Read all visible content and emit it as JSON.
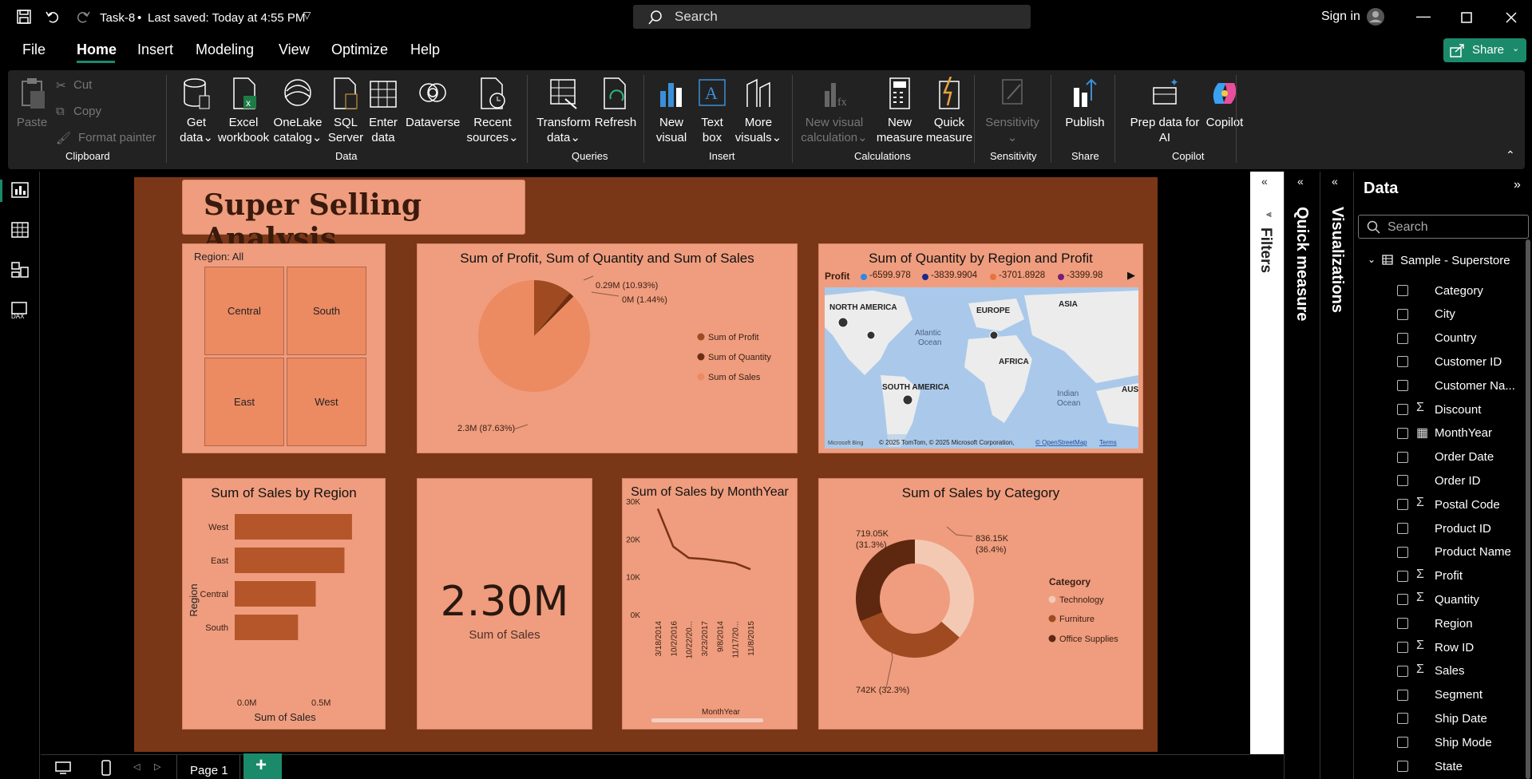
{
  "titlebar": {
    "doc_title": "Task-8",
    "saved": "Last saved: Today at 4:55 PM",
    "search": "Search",
    "signin": "Sign in"
  },
  "menu": {
    "file": "File",
    "home": "Home",
    "insert": "Insert",
    "modeling": "Modeling",
    "view": "View",
    "optimize": "Optimize",
    "help": "Help",
    "share": "Share"
  },
  "ribbon": {
    "paste": "Paste",
    "cut": "Cut",
    "copy": "Copy",
    "format_painter": "Format painter",
    "clipboard": "Clipboard",
    "get_data": "Get",
    "get_data2": "data",
    "excel": "Excel",
    "excel2": "workbook",
    "onelake": "OneLake",
    "onelake2": "catalog",
    "sql": "SQL",
    "sql2": "Server",
    "enter": "Enter",
    "enter2": "data",
    "dataverse": "Dataverse",
    "recent": "Recent",
    "recent2": "sources",
    "data_group": "Data",
    "transform": "Transform",
    "transform2": "data",
    "refresh": "Refresh",
    "queries": "Queries",
    "new_visual": "New",
    "new_visual2": "visual",
    "textbox": "Text",
    "textbox2": "box",
    "more_visuals": "More",
    "more_visuals2": "visuals",
    "insert_group": "Insert",
    "new_visual_calc": "New visual",
    "new_visual_calc2": "calculation",
    "new_measure": "New",
    "new_measure2": "measure",
    "quick_measure": "Quick",
    "quick_measure2": "measure",
    "calc_group": "Calculations",
    "sensitivity": "Sensitivity",
    "sensitivity_group": "Sensitivity",
    "publish": "Publish",
    "share_group": "Share",
    "prep": "Prep data for",
    "prep2": "AI",
    "copilot": "Copilot",
    "copilot_group": "Copilot"
  },
  "report": {
    "title": "Super Selling Analysis",
    "region_label": "Region: All",
    "regions": [
      "Central",
      "South",
      "East",
      "West"
    ],
    "pie_title": "Sum of Profit, Sum of Quantity and Sum of Sales",
    "pie_labels": {
      "profit": "0.29M (10.93%)",
      "quantity": "0M (1.44%)",
      "sales": "2.3M (87.63%)"
    },
    "pie_legend": [
      "Sum of Profit",
      "Sum of Quantity",
      "Sum of Sales"
    ],
    "map_title": "Sum of Quantity by Region and Profit",
    "map_legend_label": "Profit",
    "map_legend": [
      "-6599.978",
      "-3839.9904",
      "-3701.8928",
      "-3399.98"
    ],
    "map_places": {
      "na": "NORTH AMERICA",
      "eu": "EUROPE",
      "asia": "ASIA",
      "atl": "Atlantic",
      "atl2": "Ocean",
      "africa": "AFRICA",
      "sa": "SOUTH AMERICA",
      "ind": "Indian",
      "ind2": "Ocean",
      "aus": "AUST"
    },
    "map_attrib": "© 2025 TomTom, © 2025 Microsoft Corporation,",
    "map_osm": "© OpenStreetMap",
    "map_terms": "Terms",
    "map_bing": "Microsoft Bing",
    "bar_title": "Sum of Sales by Region",
    "bar_xlabel": "Sum of Sales",
    "bar_ylabel": "Region",
    "kpi_value": "2.30M",
    "kpi_label": "Sum of Sales",
    "line_title": "Sum of Sales by MonthYear",
    "line_xlabel": "MonthYear",
    "donut_title": "Sum of Sales by Category",
    "donut_labels": {
      "tech": "836.15K",
      "tech2": "(36.4%)",
      "furn": "742K (32.3%)",
      "off": "719.05K",
      "off2": "(31.3%)"
    },
    "donut_legend_title": "Category",
    "donut_legend": [
      "Technology",
      "Furniture",
      "Office Supplies"
    ]
  },
  "chart_data": [
    {
      "type": "pie",
      "title": "Sum of Profit, Sum of Quantity and Sum of Sales",
      "categories": [
        "Sum of Profit",
        "Sum of Quantity",
        "Sum of Sales"
      ],
      "values": [
        0.29,
        0.038,
        2.3
      ],
      "percent": [
        10.93,
        1.44,
        87.63
      ]
    },
    {
      "type": "bar",
      "title": "Sum of Sales by Region",
      "categories": [
        "West",
        "East",
        "Central",
        "South"
      ],
      "values": [
        725458,
        678781,
        501240,
        391722
      ],
      "xlabel": "Sum of Sales",
      "ylabel": "Region",
      "xticks": [
        "0.0M",
        "0.5M"
      ],
      "xlim": [
        0,
        800000
      ]
    },
    {
      "type": "line",
      "title": "Sum of Sales by MonthYear",
      "x": [
        "3/18/2014",
        "10/2/2016",
        "10/22/20...",
        "3/23/2017",
        "9/8/2014",
        "11/17/20...",
        "11/8/2015"
      ],
      "values": [
        28000,
        18000,
        15000,
        14700,
        14200,
        13600,
        12000
      ],
      "ylim": [
        0,
        30000
      ],
      "yticks": [
        "0K",
        "10K",
        "20K",
        "30K"
      ],
      "xlabel": "MonthYear"
    },
    {
      "type": "pie",
      "title": "Sum of Sales by Category",
      "categories": [
        "Technology",
        "Furniture",
        "Office Supplies"
      ],
      "values": [
        836150,
        742000,
        719050
      ],
      "percent": [
        36.4,
        32.3,
        31.3
      ]
    }
  ],
  "pages": {
    "page1": "Page 1"
  },
  "panes": {
    "filters": "Filters",
    "quick_measure": "Quick measure",
    "visualizations": "Visualizations",
    "data": "Data",
    "search": "Search",
    "table": "Sample - Superstore"
  },
  "fields": [
    {
      "name": "Category",
      "icon": ""
    },
    {
      "name": "City",
      "icon": ""
    },
    {
      "name": "Country",
      "icon": ""
    },
    {
      "name": "Customer ID",
      "icon": ""
    },
    {
      "name": "Customer Na...",
      "icon": ""
    },
    {
      "name": "Discount",
      "icon": "Σ"
    },
    {
      "name": "MonthYear",
      "icon": "▦"
    },
    {
      "name": "Order Date",
      "icon": ""
    },
    {
      "name": "Order ID",
      "icon": ""
    },
    {
      "name": "Postal Code",
      "icon": "Σ"
    },
    {
      "name": "Product ID",
      "icon": ""
    },
    {
      "name": "Product Name",
      "icon": ""
    },
    {
      "name": "Profit",
      "icon": "Σ"
    },
    {
      "name": "Quantity",
      "icon": "Σ"
    },
    {
      "name": "Region",
      "icon": ""
    },
    {
      "name": "Row ID",
      "icon": "Σ"
    },
    {
      "name": "Sales",
      "icon": "Σ"
    },
    {
      "name": "Segment",
      "icon": ""
    },
    {
      "name": "Ship Date",
      "icon": ""
    },
    {
      "name": "Ship Mode",
      "icon": ""
    },
    {
      "name": "State",
      "icon": ""
    }
  ],
  "colors": {
    "canvas": "#7a3717",
    "card": "#ef9d7e",
    "accent": "#1b8a6b"
  }
}
